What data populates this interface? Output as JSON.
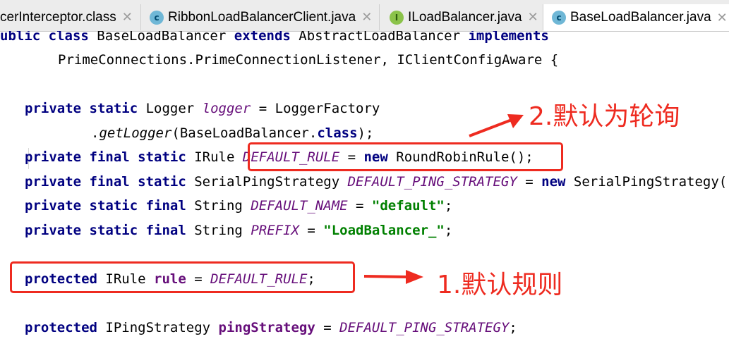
{
  "tabs": [
    {
      "label": "cerInterceptor.class",
      "icon": "class-file-icon",
      "icon_letter": "",
      "active": false
    },
    {
      "label": "RibbonLoadBalancerClient.java",
      "icon": "java-class-icon",
      "icon_letter": "c",
      "active": false
    },
    {
      "label": "ILoadBalancer.java",
      "icon": "java-interface-icon",
      "icon_letter": "I",
      "active": false
    },
    {
      "label": "BaseLoadBalancer.java",
      "icon": "java-class-icon",
      "icon_letter": "c",
      "active": true
    }
  ],
  "colors": {
    "annotation": "#ee2b20",
    "keyword": "#000080",
    "field": "#660e7a",
    "string": "#008000"
  },
  "code": {
    "l1": {
      "t0": "ublic class ",
      "t1": "BaseLoadBalancer ",
      "t2": "extends ",
      "t3": "AbstractLoadBalancer ",
      "t4": "implements"
    },
    "l2": {
      "t0": "PrimeConnections.PrimeConnectionListener, IClientConfigAware {"
    },
    "l4": {
      "k1": "private ",
      "k2": "static ",
      "ty": "Logger ",
      "f": "logger",
      "rest": " = LoggerFactory"
    },
    "l5": {
      "dot": ".",
      "m": "getLogger",
      "a": "(BaseLoadBalancer.",
      "k": "class",
      "e": ");"
    },
    "l6": {
      "k1": "private ",
      "k2": "final ",
      "k3": "static ",
      "ty": "IRule ",
      "f": "DEFAULT_RULE",
      "eq": " = ",
      "k4": "new ",
      "rest": "RoundRobinRule();"
    },
    "l7": {
      "k1": "private ",
      "k2": "final ",
      "k3": "static ",
      "ty": "SerialPingStrategy ",
      "f": "DEFAULT_PING_STRATEGY",
      "eq": " = ",
      "k4": "new ",
      "rest": "SerialPingStrategy();"
    },
    "l8": {
      "k1": "private ",
      "k2": "static ",
      "k3": "final ",
      "ty": "String ",
      "f": "DEFAULT_NAME",
      "eq": " = ",
      "s": "\"default\"",
      "e": ";"
    },
    "l9": {
      "k1": "private ",
      "k2": "static ",
      "k3": "final ",
      "ty": "String ",
      "f": "PREFIX",
      "eq": " = ",
      "s": "\"LoadBalancer_\"",
      "e": ";"
    },
    "l11": {
      "k1": "protected ",
      "ty": "IRule ",
      "v": "rule",
      "eq": " = ",
      "f": "DEFAULT_RULE",
      "e": ";"
    },
    "l13": {
      "k1": "protected ",
      "ty": "IPingStrategy ",
      "v": "pingStrategy",
      "eq": " = ",
      "f": "DEFAULT_PING_STRATEGY",
      "e": ";"
    }
  },
  "annotations": {
    "default_rule": "1.默认规则",
    "round_robin": "2.默认为轮询"
  }
}
